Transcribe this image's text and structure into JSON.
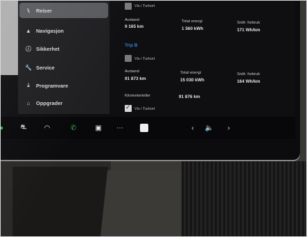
{
  "sidebar": {
    "items": [
      {
        "label": "Reiser",
        "icon": "trips-icon",
        "glyph": "⑊"
      },
      {
        "label": "Navigasjon",
        "icon": "navigation-icon",
        "glyph": "▲"
      },
      {
        "label": "Sikkerhet",
        "icon": "safety-icon",
        "glyph": "ⓘ"
      },
      {
        "label": "Service",
        "icon": "wrench-icon",
        "glyph": "🔧"
      },
      {
        "label": "Programvare",
        "icon": "download-icon",
        "glyph": "⤓"
      },
      {
        "label": "Oppgrader",
        "icon": "lock-icon",
        "glyph": "⌂"
      }
    ],
    "selected_index": 0
  },
  "main": {
    "top_checkbox_label": "Vis i Turkort",
    "section_a": {
      "distance_label": "Avstand",
      "distance_value": "9 165 km",
      "energy_label": "Total energi",
      "energy_value": "1 560 kWh",
      "avg_label": "Snitt- forbruk",
      "avg_value": "171 Wh/km"
    },
    "trip_b_title": "Trip B",
    "trip_b_checkbox_label": "Vis i Turkort",
    "section_b": {
      "distance_label": "Avstand",
      "distance_value": "91 873 km",
      "energy_label": "Total energi",
      "energy_value": "15 030 kWh",
      "avg_label": "Snitt- forbruk",
      "avg_value": "164 Wh/km"
    },
    "odometer_label": "Kilometerteller",
    "odometer_value": "91 876 km",
    "odometer_checkbox_label": "Vis i Turkort"
  },
  "taskbar": {
    "icons": [
      "car-icon",
      "wiper-icon",
      "phone-icon",
      "media-icon",
      "more-icon",
      "app-icon",
      "chevron-left-icon",
      "volume-icon",
      "chevron-right-icon"
    ],
    "colors": {
      "phone": "#2fb84a"
    }
  }
}
